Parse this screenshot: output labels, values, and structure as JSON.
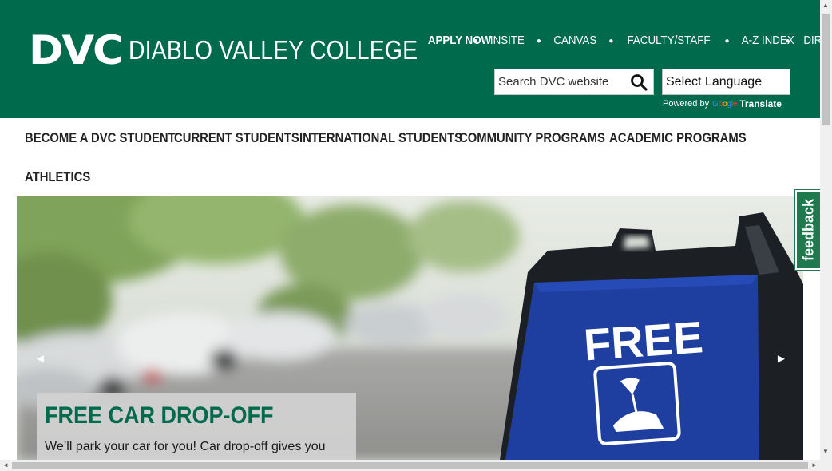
{
  "brand": {
    "logo_mark": "DVC",
    "logo_text": "DIABLO VALLEY COLLEGE",
    "primary_color": "#006a4d"
  },
  "top_links": [
    {
      "label": "APPLY NOW"
    },
    {
      "label": "INSITE"
    },
    {
      "label": "CANVAS"
    },
    {
      "label": "FACULTY/STAFF"
    },
    {
      "label": "A-Z INDEX"
    },
    {
      "label": "DIRECTORY"
    }
  ],
  "search": {
    "placeholder": "Search DVC website",
    "icon": "search-icon"
  },
  "translate": {
    "select_label": "Select Language",
    "powered_by": "Powered by",
    "google": "Google",
    "translate_label": "Translate"
  },
  "main_nav": [
    {
      "label": "BECOME A DVC STUDENT"
    },
    {
      "label": "CURRENT STUDENTS"
    },
    {
      "label": "INTERNATIONAL STUDENTS"
    },
    {
      "label": "COMMUNITY PROGRAMS"
    },
    {
      "label": "ACADEMIC PROGRAMS"
    },
    {
      "label": "ATHLETICS"
    }
  ],
  "hero": {
    "sign_text": "FREE",
    "prev_icon": "◄",
    "next_icon": "►",
    "caption_title": "FREE CAR DROP-OFF",
    "caption_text": "We’ll park your car for you! Car drop-off gives you",
    "sign_color": "#1f3fa0"
  },
  "feedback": {
    "label": "feedback",
    "color": "#1e7a4c"
  }
}
